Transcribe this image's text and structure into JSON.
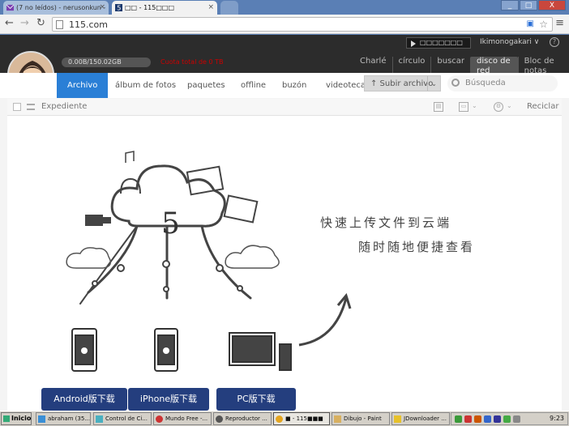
{
  "browser": {
    "tabs": [
      {
        "title": "(7 no leídos) - nerusonkun -"
      },
      {
        "title": "□□ - 115□□□"
      }
    ],
    "address": "115.com",
    "window_controls": {
      "minimize": "_",
      "maximize": "□",
      "close": "X"
    }
  },
  "header": {
    "player_text": "□□□□□□□",
    "user_name": "Ikimonogakari",
    "quota": {
      "text": "0.00B/150.02GB",
      "used_fraction": 0.0
    },
    "quota_note": "Cuota total de 0 TB",
    "links": [
      {
        "label": "Charlé",
        "selected": false
      },
      {
        "label": "círculo",
        "selected": false
      },
      {
        "label": "buscar",
        "selected": false
      },
      {
        "label": "disco de red",
        "selected": true
      },
      {
        "label": "Bloc de notas",
        "selected": false
      }
    ]
  },
  "tabs": {
    "items": [
      {
        "label": "Archivo",
        "active": true
      },
      {
        "label": "álbum de fotos",
        "active": false
      },
      {
        "label": "paquetes",
        "active": false
      },
      {
        "label": "offline",
        "active": false
      },
      {
        "label": "buzón",
        "active": false
      },
      {
        "label": "videoteca",
        "active": false
      }
    ],
    "upload_label": "↑ Subir archivo",
    "search_placeholder": "Búsqueda"
  },
  "subbar": {
    "expediente": "Expediente",
    "reciclar": "Reciclar"
  },
  "promo": {
    "slogan_line1": "快速上传文件到云端",
    "slogan_line2": "随时随地便捷查看",
    "cloud_number": "5",
    "buttons": [
      {
        "label": "Android版下载"
      },
      {
        "label": "iPhone版下载"
      },
      {
        "label": "PC版下载"
      }
    ]
  },
  "taskbar": {
    "start_label": "Inicio",
    "buttons": [
      {
        "label": "abraham (35..."
      },
      {
        "label": "Control de Ci..."
      },
      {
        "label": "Mundo Free -..."
      },
      {
        "label": "Reproductor ..."
      },
      {
        "label": "■ - 115■■■"
      },
      {
        "label": "Dibujo - Paint"
      },
      {
        "label": "JDownloader ..."
      }
    ],
    "clock": "9:23"
  },
  "colors": {
    "accent_blue": "#2a7fd6",
    "download_button": "#243e7e",
    "header_dark": "#2c2c2c"
  }
}
